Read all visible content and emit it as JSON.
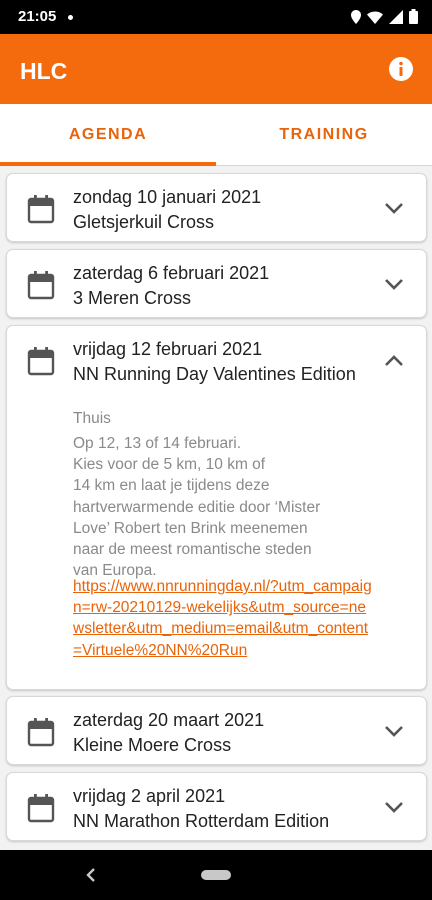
{
  "status_bar": {
    "time": "21:05"
  },
  "app_bar": {
    "title": "HLC",
    "info_icon": "info-icon"
  },
  "tabs": [
    {
      "label": "AGENDA",
      "selected": true
    },
    {
      "label": "TRAINING",
      "selected": false
    }
  ],
  "events": [
    {
      "date": "zondag 10 januari 2021",
      "title": "Gletsjerkuil Cross",
      "expanded": false
    },
    {
      "date": "zaterdag 6 februari 2021",
      "title": "3 Meren Cross",
      "expanded": false
    },
    {
      "date": "vrijdag 12 februari 2021",
      "title": "NN Running Day Valentines Edition",
      "expanded": true,
      "location": "Thuis",
      "description": [
        "Op 12, 13 of 14 februari.",
        "Kies voor de 5 km, 10 km of",
        "14 km en laat je tijdens deze",
        "hartverwarmende editie door ‘Mister",
        "Love’ Robert ten Brink meenemen",
        "naar de meest romantische steden",
        "van Europa."
      ],
      "link": "https://www.nnrunningday.nl/?utm_campaign=rw-20210129-wekelijks&utm_source=newsletter&utm_medium=email&utm_content=Virtuele%20NN%20Run"
    },
    {
      "date": "zaterdag 20 maart 2021",
      "title": "Kleine Moere Cross",
      "expanded": false
    },
    {
      "date": "vrijdag 2 april 2021",
      "title": "NN Marathon Rotterdam Edition",
      "expanded": false
    }
  ],
  "colors": {
    "accent": "#f36b0c",
    "text": "#222222",
    "muted": "#8a8a8a",
    "background": "#f2f2f2"
  }
}
